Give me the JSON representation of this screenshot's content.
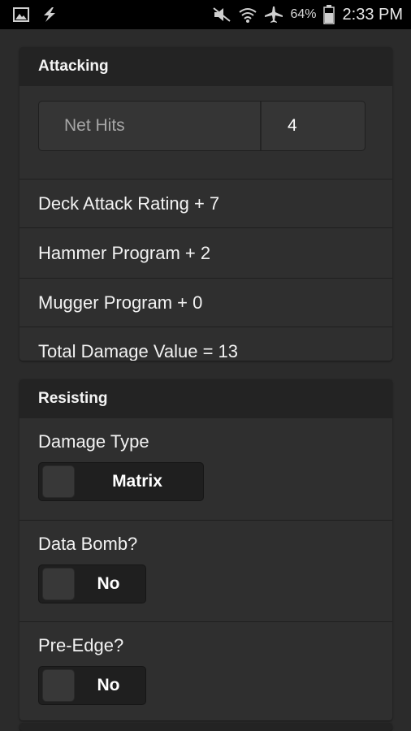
{
  "status_bar": {
    "battery_percent": "64%",
    "time": "2:33 PM",
    "icons": [
      "image-icon",
      "flash-icon",
      "mute-icon",
      "wifi-icon",
      "airplane-icon",
      "battery-icon"
    ]
  },
  "attacking": {
    "title": "Attacking",
    "net_hits": {
      "label": "Net Hits",
      "value": "4"
    },
    "rows": [
      "Deck Attack Rating + 7",
      "Hammer Program + 2",
      "Mugger Program + 0",
      "Total Damage Value = 13"
    ]
  },
  "resisting": {
    "title": "Resisting",
    "damage_type": {
      "label": "Damage Type",
      "value": "Matrix"
    },
    "data_bomb": {
      "label": "Data Bomb?",
      "value": "No"
    },
    "pre_edge": {
      "label": "Pre-Edge?",
      "value": "No"
    }
  },
  "colors": {
    "background": "#2b2b2b",
    "card": "#2f2f2f",
    "header": "#232323",
    "statusbar": "#000000"
  }
}
